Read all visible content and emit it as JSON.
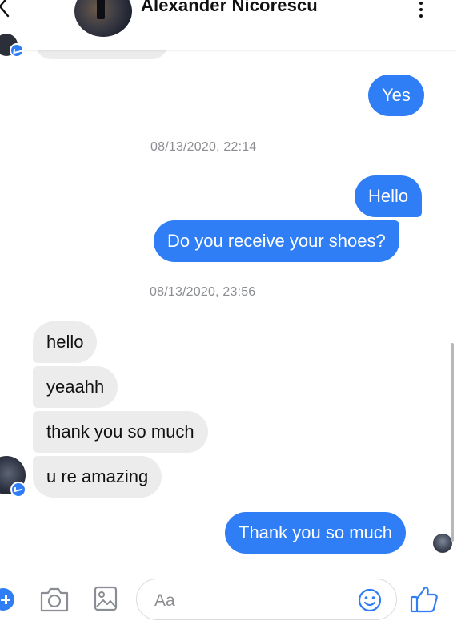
{
  "header": {
    "contact_name": "Alexander Nicorescu"
  },
  "messages": [
    {
      "type": "outgoing",
      "text": "Yes"
    },
    {
      "type": "timestamp",
      "text": "08/13/2020, 22:14"
    },
    {
      "type": "outgoing",
      "text": "Hello"
    },
    {
      "type": "outgoing",
      "text": "Do you receive your shoes?"
    },
    {
      "type": "timestamp",
      "text": "08/13/2020, 23:56"
    },
    {
      "type": "incoming",
      "text": "hello"
    },
    {
      "type": "incoming",
      "text": "yeaahh"
    },
    {
      "type": "incoming",
      "text": "thank you so much"
    },
    {
      "type": "incoming",
      "text": "u re amazing"
    },
    {
      "type": "outgoing",
      "text": "Thank you so much"
    }
  ],
  "composer": {
    "placeholder": "Aa"
  },
  "colors": {
    "outgoing_bubble": "#2f7ef6",
    "incoming_bubble": "#ececec",
    "accent": "#2f7ef6"
  },
  "icons": {
    "back": "chevron-left-icon",
    "menu": "more-vertical-icon",
    "plus": "plus-icon",
    "camera": "camera-icon",
    "gallery": "image-icon",
    "emoji": "smiley-icon",
    "like": "thumbs-up-icon"
  }
}
